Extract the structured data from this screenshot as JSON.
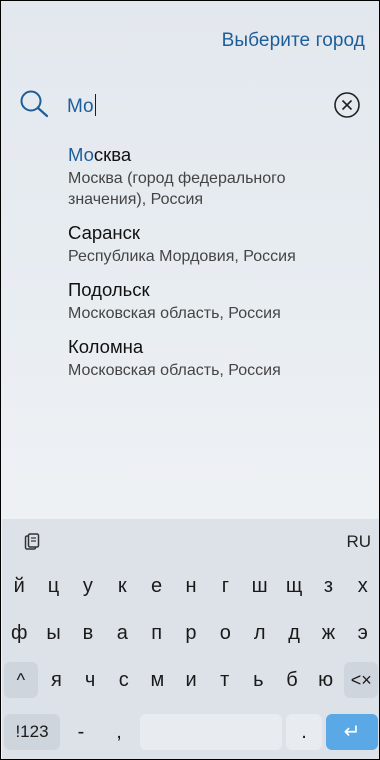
{
  "header": {
    "choose_city_label": "Выберите город"
  },
  "search": {
    "match": "Мо",
    "query": "Мо",
    "icon": "search-icon",
    "clear_icon": "clear-icon"
  },
  "results": [
    {
      "match": "Мо",
      "rest": "сква",
      "title": "Москва",
      "subtitle": "Москва (город федерального значения), Россия"
    },
    {
      "match": "",
      "rest": "Саранск",
      "title": "Саранск",
      "subtitle": "Республика Мордовия, Россия"
    },
    {
      "match": "",
      "rest": "Подольск",
      "title": "Подольск",
      "subtitle": "Московская область, Россия"
    },
    {
      "match": "",
      "rest": "Коломна",
      "title": "Коломна",
      "subtitle": "Московская область, Россия"
    }
  ],
  "keyboard": {
    "language": "RU",
    "row1": [
      "й",
      "ц",
      "у",
      "к",
      "е",
      "н",
      "г",
      "ш",
      "щ",
      "з",
      "х"
    ],
    "row2": [
      "ф",
      "ы",
      "в",
      "а",
      "п",
      "р",
      "о",
      "л",
      "д",
      "ж",
      "э"
    ],
    "row3": [
      "^",
      "я",
      "ч",
      "с",
      "м",
      "и",
      "т",
      "ь",
      "б",
      "ю",
      "<×"
    ],
    "row4": {
      "symbols": "!123",
      "dash": "-",
      "comma": ",",
      "space": "",
      "dot": ".",
      "enter": "↵"
    }
  },
  "colors": {
    "accent": "#1d5e99",
    "enter_key": "#5aa8e6"
  }
}
